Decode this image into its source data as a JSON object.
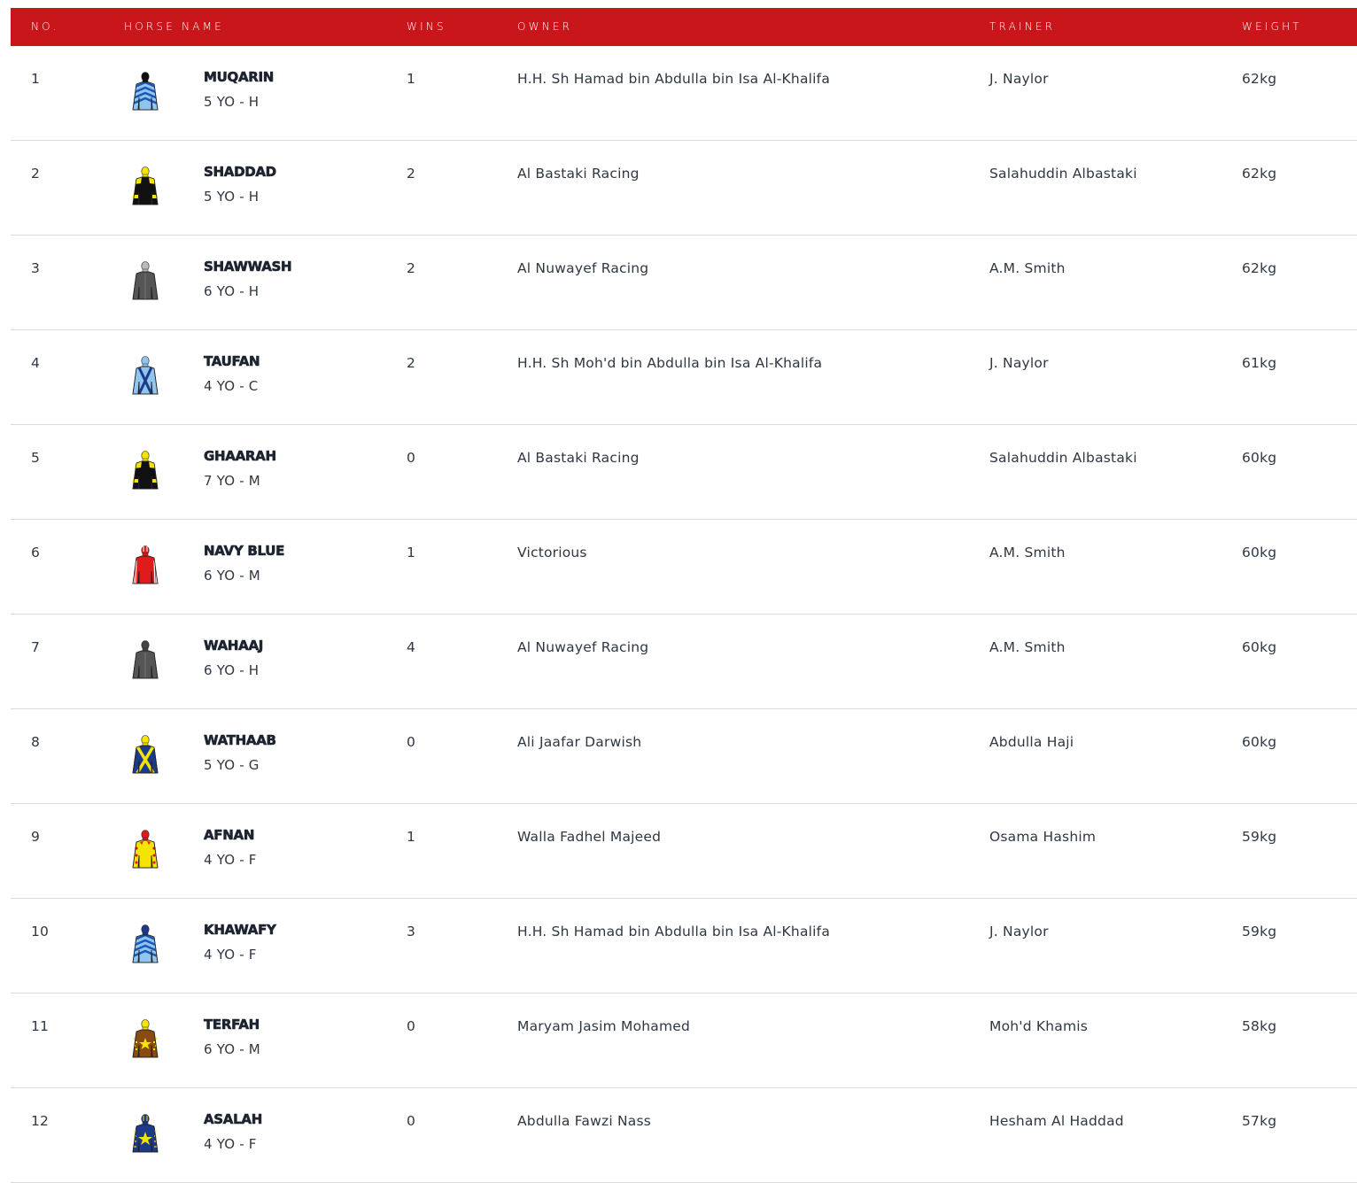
{
  "header": {
    "no": "NO.",
    "horse_name": "HORSE NAME",
    "wins": "WINS",
    "owner": "OWNER",
    "trainer": "TRAINER",
    "weight": "WEIGHT"
  },
  "colors": {
    "header_bg": "#c8161b",
    "header_text": "#ffffff",
    "row_divider": "#d9d9d9"
  },
  "rows": [
    {
      "no": "1",
      "name": "MUQARIN",
      "meta": "5 YO - H",
      "wins": "1",
      "owner": "H.H. Sh Hamad bin Abdulla bin Isa Al-Khalifa",
      "trainer": "J. Naylor",
      "weight": "62kg",
      "silk": "light-blue-chevrons-silk-icon"
    },
    {
      "no": "2",
      "name": "SHADDAD",
      "meta": "5 YO - H",
      "wins": "2",
      "owner": "Al Bastaki Racing",
      "trainer": "Salahuddin Albastaki",
      "weight": "62kg",
      "silk": "black-yellow-epaulets-silk-icon"
    },
    {
      "no": "3",
      "name": "SHAWWASH",
      "meta": "6 YO - H",
      "wins": "2",
      "owner": "Al Nuwayef Racing",
      "trainer": "A.M. Smith",
      "weight": "62kg",
      "silk": "grey-silk-icon"
    },
    {
      "no": "4",
      "name": "TAUFAN",
      "meta": "4 YO - C",
      "wins": "2",
      "owner": "H.H. Sh Moh'd bin Abdulla bin Isa Al-Khalifa",
      "trainer": "J. Naylor",
      "weight": "61kg",
      "silk": "light-blue-cross-belts-silk-icon"
    },
    {
      "no": "5",
      "name": "GHAARAH",
      "meta": "7 YO - M",
      "wins": "0",
      "owner": "Al Bastaki Racing",
      "trainer": "Salahuddin Albastaki",
      "weight": "60kg",
      "silk": "black-yellow-epaulets-silk-icon"
    },
    {
      "no": "6",
      "name": "NAVY BLUE",
      "meta": "6 YO - M",
      "wins": "1",
      "owner": "Victorious",
      "trainer": "A.M. Smith",
      "weight": "60kg",
      "silk": "red-striped-sleeves-silk-icon"
    },
    {
      "no": "7",
      "name": "WAHAAJ",
      "meta": "6 YO - H",
      "wins": "4",
      "owner": "Al Nuwayef Racing",
      "trainer": "A.M. Smith",
      "weight": "60kg",
      "silk": "dark-grey-silk-icon"
    },
    {
      "no": "8",
      "name": "WATHAAB",
      "meta": "5 YO - G",
      "wins": "0",
      "owner": "Ali Jaafar Darwish",
      "trainer": "Abdulla Haji",
      "weight": "60kg",
      "silk": "navy-yellow-cross-silk-icon"
    },
    {
      "no": "9",
      "name": "AFNAN",
      "meta": "4 YO - F",
      "wins": "1",
      "owner": "Walla Fadhel Majeed",
      "trainer": "Osama Hashim",
      "weight": "59kg",
      "silk": "yellow-red-diamonds-silk-icon"
    },
    {
      "no": "10",
      "name": "KHAWAFY",
      "meta": "4 YO - F",
      "wins": "3",
      "owner": "H.H. Sh Hamad bin Abdulla bin Isa Al-Khalifa",
      "trainer": "J. Naylor",
      "weight": "59kg",
      "silk": "light-blue-chevrons-navy-cap-silk-icon"
    },
    {
      "no": "11",
      "name": "TERFAH",
      "meta": "6 YO - M",
      "wins": "0",
      "owner": "Maryam Jasim Mohamed",
      "trainer": "Moh'd Khamis",
      "weight": "58kg",
      "silk": "brown-yellow-star-silk-icon"
    },
    {
      "no": "12",
      "name": "ASALAH",
      "meta": "4 YO - F",
      "wins": "0",
      "owner": "Abdulla Fawzi Nass",
      "trainer": "Hesham Al Haddad",
      "weight": "57kg",
      "silk": "blue-yellow-star-silk-icon"
    }
  ]
}
